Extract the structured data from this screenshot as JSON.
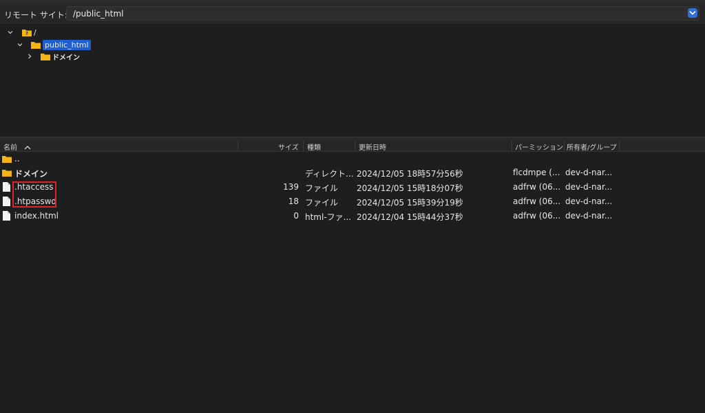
{
  "remote": {
    "label": "リモート サイト:",
    "path": "/public_html"
  },
  "tree": [
    {
      "label": "/"
    },
    {
      "label": "public_html",
      "selected": true
    },
    {
      "label": "ドメイン"
    }
  ],
  "columns": {
    "name": "名前",
    "size": "サイズ",
    "type": "種類",
    "modified": "更新日時",
    "perms": "パーミッション",
    "owner": "所有者/グループ"
  },
  "files": [
    {
      "name": "..",
      "size": "",
      "type": "",
      "modified": "",
      "perms": "",
      "owner": "",
      "icon": "folder"
    },
    {
      "name": "ドメイン",
      "size": "",
      "type": "ディレクト...",
      "modified": "2024/12/05 18時57分56秒",
      "perms": "flcdmpe (...",
      "owner": "dev-d-nar...",
      "icon": "folder"
    },
    {
      "name": ".htaccess",
      "size": "139",
      "type": "ファイル",
      "modified": "2024/12/05 15時18分07秒",
      "perms": "adfrw (06...",
      "owner": "dev-d-nar...",
      "icon": "file"
    },
    {
      "name": ".htpasswd",
      "size": "18",
      "type": "ファイル",
      "modified": "2024/12/05 15時39分19秒",
      "perms": "adfrw (06...",
      "owner": "dev-d-nar...",
      "icon": "file"
    },
    {
      "name": "index.html",
      "size": "0",
      "type": "html-ファ...",
      "modified": "2024/12/04 15時44分37秒",
      "perms": "adfrw (06...",
      "owner": "dev-d-nar...",
      "icon": "file"
    }
  ],
  "colors": {
    "accent": "#1f5fd1",
    "folder": "#f5b514",
    "highlight": "#e0242a"
  }
}
